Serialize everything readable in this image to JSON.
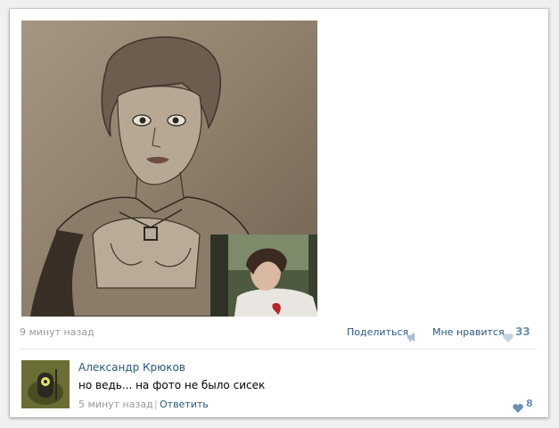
{
  "post": {
    "time": "9 минут назад",
    "share_label": "Поделиться",
    "like_label": "Мне нравится",
    "like_count": "33"
  },
  "comment": {
    "author": "Александр Крюков",
    "text": "но ведь... на фото не было сисек",
    "time": "5 минут назад",
    "separator": "|",
    "reply_label": "Ответить",
    "like_count": "8"
  },
  "colors": {
    "link": "#2b587a",
    "meta": "#999999",
    "like_heart": "#6d8fb3",
    "liked_heart_inactive": "#c5d3e2"
  },
  "icons": [
    "megaphone-icon",
    "heart-icon"
  ]
}
